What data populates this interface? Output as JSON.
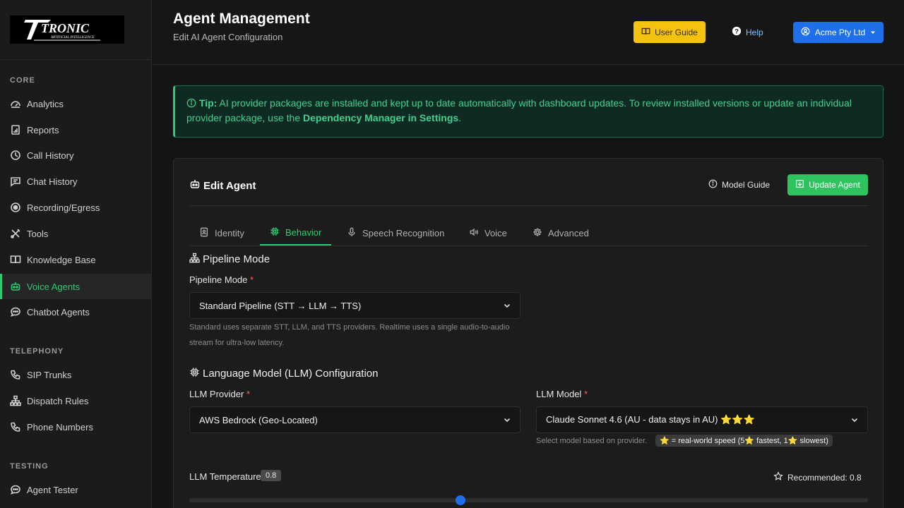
{
  "sidebar": {
    "logo_text": "TRONIC",
    "logo_sub": "ARTIFICIAL INTELLIGENCE",
    "sections": {
      "core": "CORE",
      "telephony": "TELEPHONY",
      "testing": "TESTING"
    },
    "items": [
      {
        "label": "Analytics",
        "icon": "analytics-icon"
      },
      {
        "label": "Reports",
        "icon": "report-icon"
      },
      {
        "label": "Call History",
        "icon": "clock-icon"
      },
      {
        "label": "Chat History",
        "icon": "chat-lines-icon"
      },
      {
        "label": "Recording/Egress",
        "icon": "record-icon"
      },
      {
        "label": "Tools",
        "icon": "tools-icon"
      },
      {
        "label": "Knowledge Base",
        "icon": "book-icon"
      },
      {
        "label": "Voice Agents",
        "icon": "robot-icon",
        "active": true
      },
      {
        "label": "Chatbot Agents",
        "icon": "chat-bubble-icon"
      },
      {
        "label": "SIP Trunks",
        "icon": "phone-icon"
      },
      {
        "label": "Dispatch Rules",
        "icon": "hierarchy-icon"
      },
      {
        "label": "Phone Numbers",
        "icon": "phone-icon"
      },
      {
        "label": "Agent Tester",
        "icon": "chat-bubble-icon"
      }
    ]
  },
  "header": {
    "title": "Agent Management",
    "subtitle": "Edit AI Agent Configuration",
    "user_guide": "User Guide",
    "help": "Help",
    "account": "Acme Pty Ltd"
  },
  "tip": {
    "label": "Tip:",
    "text": " AI provider packages are installed and kept up to date automatically with dashboard updates. To review installed versions or update an individual provider package, use the ",
    "link": "Dependency Manager in Settings",
    "end": "."
  },
  "card": {
    "title": "Edit Agent",
    "model_guide": "Model Guide",
    "update_agent": "Update Agent",
    "tabs": [
      "Identity",
      "Behavior",
      "Speech Recognition",
      "Voice",
      "Advanced"
    ],
    "active_tab": "Behavior"
  },
  "pipeline": {
    "heading": "Pipeline Mode",
    "label": "Pipeline Mode",
    "required": "*",
    "value": "Standard Pipeline (STT → LLM → TTS)",
    "help_line1": "Standard uses separate STT, LLM, and TTS providers. Realtime uses a single audio-to-audio",
    "help_line2": "stream for ultra-low latency."
  },
  "llm": {
    "heading": "Language Model (LLM) Configuration",
    "provider_label": "LLM Provider",
    "provider_value": "AWS Bedrock (Geo-Located)",
    "model_label": "LLM Model",
    "model_value": "Claude Sonnet 4.6 (AU - data stays in AU) ⭐⭐⭐",
    "model_help": "Select model based on provider.",
    "speed_legend": "⭐ = real-world speed (5⭐ fastest, 1⭐ slowest)",
    "required": "*"
  },
  "temperature": {
    "label": "LLM Temperature",
    "value": "0.8",
    "recommended": "Recommended: 0.8",
    "fraction": 0.4
  },
  "colors": {
    "accent_green": "#2ecc71",
    "guide_yellow": "#f5c211",
    "account_blue": "#1f6feb"
  }
}
